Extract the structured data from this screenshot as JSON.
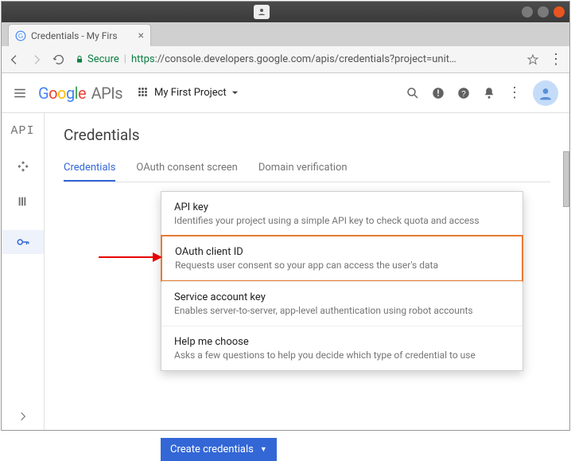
{
  "browser": {
    "tab_title": "Credentials - My Firs",
    "secure_label": "Secure",
    "url_https": "https",
    "url_rest": "://console.developers.google.com/apis/credentials?project=unit…"
  },
  "header": {
    "logo_apis": " APIs",
    "project_name": "My First Project"
  },
  "rail": {
    "api_label": "API"
  },
  "page": {
    "title": "Credentials",
    "tabs": {
      "credentials": "Credentials",
      "oauth": "OAuth consent screen",
      "domain": "Domain verification"
    }
  },
  "menu": {
    "items": [
      {
        "title": "API key",
        "desc": "Identifies your project using a simple API key to check quota and access"
      },
      {
        "title": "OAuth client ID",
        "desc": "Requests user consent so your app can access the user's data"
      },
      {
        "title": "Service account key",
        "desc": "Enables server-to-server, app-level authentication using robot accounts"
      },
      {
        "title": "Help me choose",
        "desc": "Asks a few questions to help you decide which type of credential to use"
      }
    ]
  },
  "create_button": "Create credentials"
}
